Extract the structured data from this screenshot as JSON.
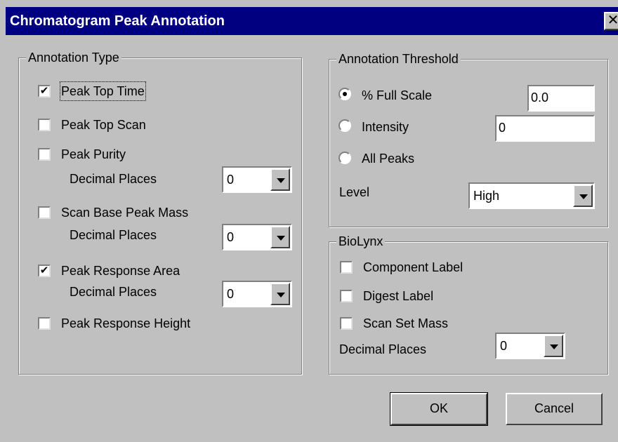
{
  "window": {
    "title": "Chromatogram Peak Annotation",
    "close_glyph": "✕"
  },
  "annotation_type": {
    "legend": "Annotation Type",
    "items": [
      {
        "label": "Peak Top Time",
        "checked": true
      },
      {
        "label": "Peak Top Scan",
        "checked": false
      },
      {
        "label": "Peak Purity",
        "checked": false
      },
      {
        "label": "Scan Base Peak Mass",
        "checked": false
      },
      {
        "label": "Peak Response Area",
        "checked": true
      },
      {
        "label": "Peak Response Height",
        "checked": false
      }
    ],
    "decimal_places_label": "Decimal Places",
    "purity_decimal_value": "0",
    "base_peak_decimal_value": "0",
    "response_area_decimal_value": "0"
  },
  "threshold": {
    "legend": "Annotation Threshold",
    "full_scale_label": "% Full Scale",
    "full_scale_value": "0.0",
    "intensity_label": "Intensity",
    "intensity_value": "0",
    "all_peaks_label": "All Peaks",
    "selected": "full_scale",
    "level_label": "Level",
    "level_value": "High"
  },
  "biolynx": {
    "legend": "BioLynx",
    "items": [
      {
        "label": "Component Label",
        "checked": false
      },
      {
        "label": "Digest Label",
        "checked": false
      },
      {
        "label": "Scan Set Mass",
        "checked": false
      }
    ],
    "decimal_places_label": "Decimal Places",
    "decimal_value": "0"
  },
  "buttons": {
    "ok": "OK",
    "cancel": "Cancel"
  },
  "check_glyph": "✔",
  "colors": {
    "titlebar": "#000080",
    "face": "#c0c0c0"
  },
  "icons": {
    "close": "close-icon",
    "dropdown": "dropdown-arrow-icon"
  }
}
